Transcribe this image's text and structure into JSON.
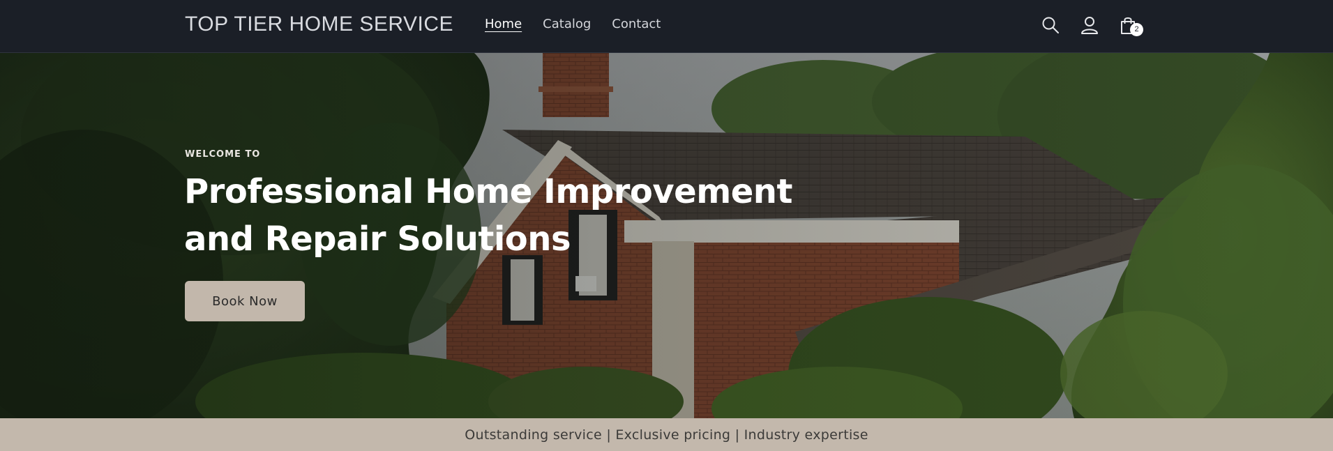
{
  "header": {
    "brand": "TOP TIER HOME SERVICE",
    "nav": [
      {
        "label": "Home",
        "active": true
      },
      {
        "label": "Catalog",
        "active": false
      },
      {
        "label": "Contact",
        "active": false
      }
    ],
    "icons": {
      "search": "search-icon",
      "account": "user-icon",
      "cart": "shopping-bag-icon"
    },
    "cart_count": "2"
  },
  "hero": {
    "eyebrow": "WELCOME TO",
    "title": "Professional Home Improvement and Repair Solutions",
    "cta_label": "Book Now"
  },
  "announcement": {
    "text": "Outstanding service | Exclusive pricing | Industry expertise"
  },
  "colors": {
    "header_bg": "#1b1f27",
    "button_bg": "#c2b7ab",
    "announcement_bg": "#c3b8ac"
  }
}
